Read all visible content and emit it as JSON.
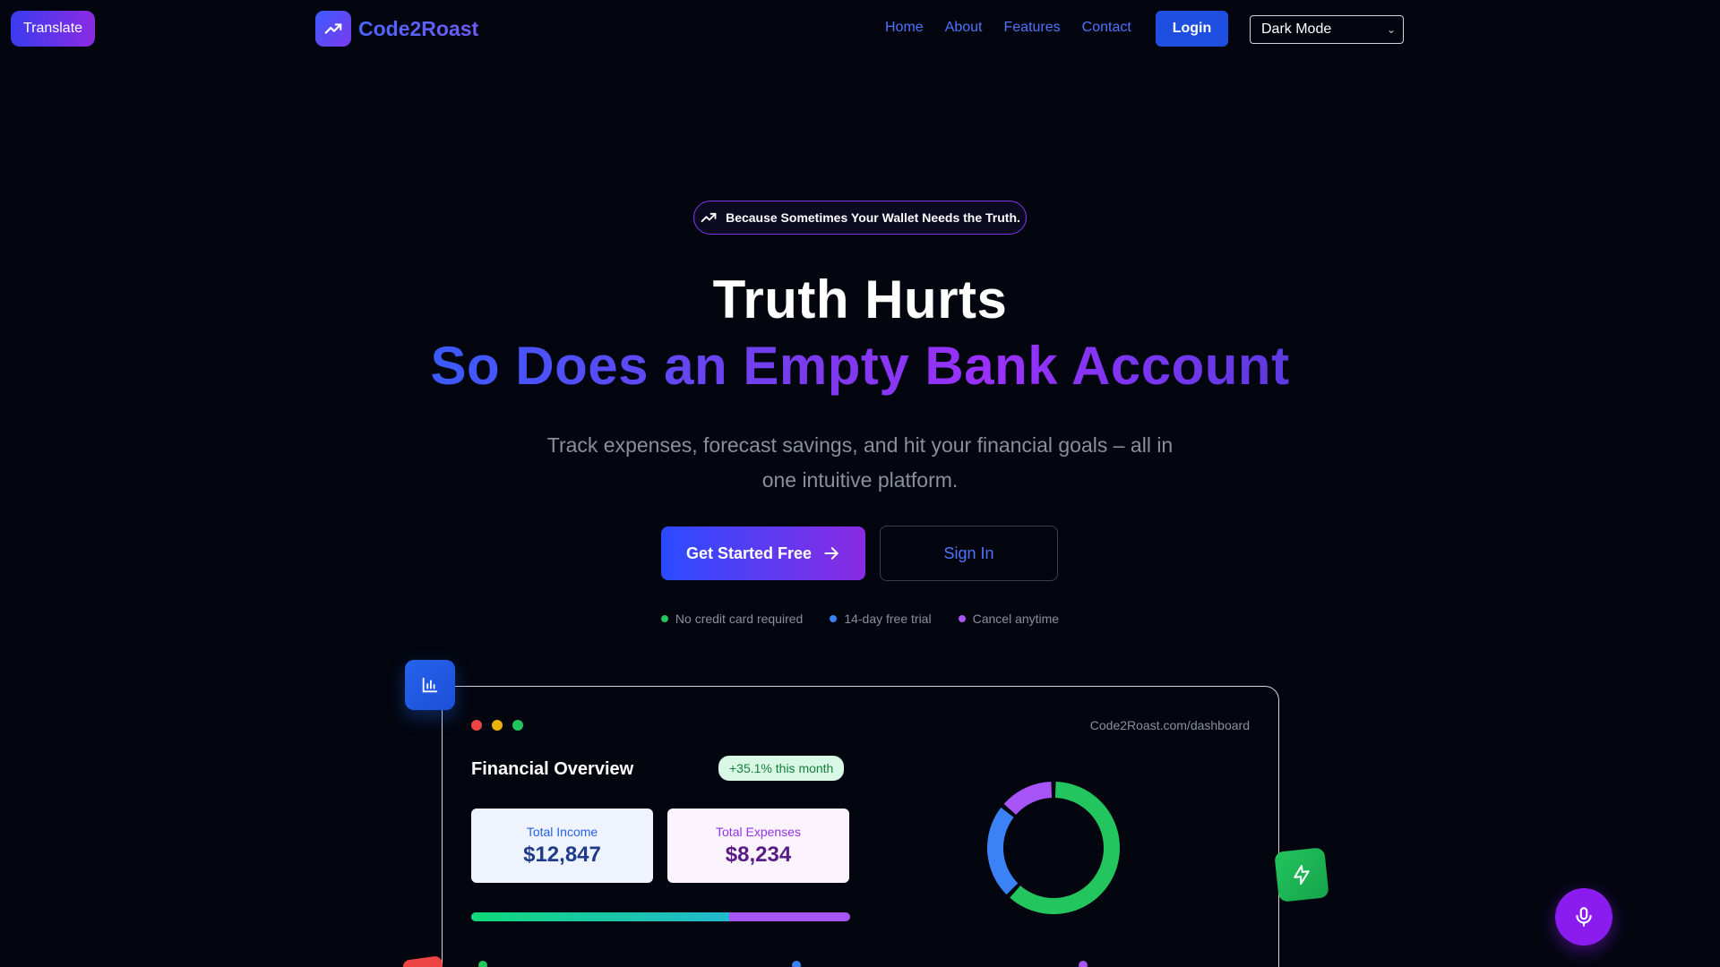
{
  "topbar": {
    "translate_label": "Translate",
    "brand_name": "Code2Roast",
    "nav": [
      "Home",
      "About",
      "Features",
      "Contact"
    ],
    "login_label": "Login",
    "mode_select_value": "Dark Mode"
  },
  "hero": {
    "pill_text": "Because Sometimes Your Wallet Needs the Truth.",
    "headline_line1": "Truth Hurts",
    "headline_line2": "So Does an Empty Bank Account",
    "subtext": "Track expenses, forecast savings, and hit your financial goals – all in one intuitive platform.",
    "cta_primary": "Get Started Free",
    "cta_secondary": "Sign In",
    "benefits": [
      {
        "text": "No credit card required",
        "color": "#22c55e"
      },
      {
        "text": "14-day free trial",
        "color": "#3b82f6"
      },
      {
        "text": "Cancel anytime",
        "color": "#a855f7"
      }
    ]
  },
  "dashboard": {
    "url": "Code2Roast.com/dashboard",
    "title": "Financial Overview",
    "growth_badge": "+35.1% this month",
    "income": {
      "label": "Total Income",
      "value": "$12,847",
      "label_color": "#2563eb",
      "value_color": "#1e3a8a"
    },
    "expenses": {
      "label": "Total Expenses",
      "value": "$8,234",
      "label_color": "#9333ea",
      "value_color": "#581c87"
    },
    "progress_fraction": 0.68,
    "donut_segments": [
      {
        "name": "green",
        "fraction": 0.62,
        "color": "#22c55e"
      },
      {
        "name": "blue",
        "fraction": 0.24,
        "color": "#3b82f6"
      },
      {
        "name": "purple",
        "fraction": 0.14,
        "color": "#a855f7"
      }
    ],
    "legend_colors": [
      "#22c55e",
      "#3b82f6",
      "#a855f7"
    ]
  },
  "colors": {
    "accent_blue": "#4f73ff",
    "accent_purple": "#7c3aed",
    "background": "#03060f"
  },
  "icons": {
    "brand": "trending-up-icon",
    "pill": "trending-up-icon",
    "cta": "arrow-right-icon",
    "float_left": "bar-chart-icon",
    "float_right": "lightning-bolt-icon",
    "mic": "microphone-icon"
  }
}
